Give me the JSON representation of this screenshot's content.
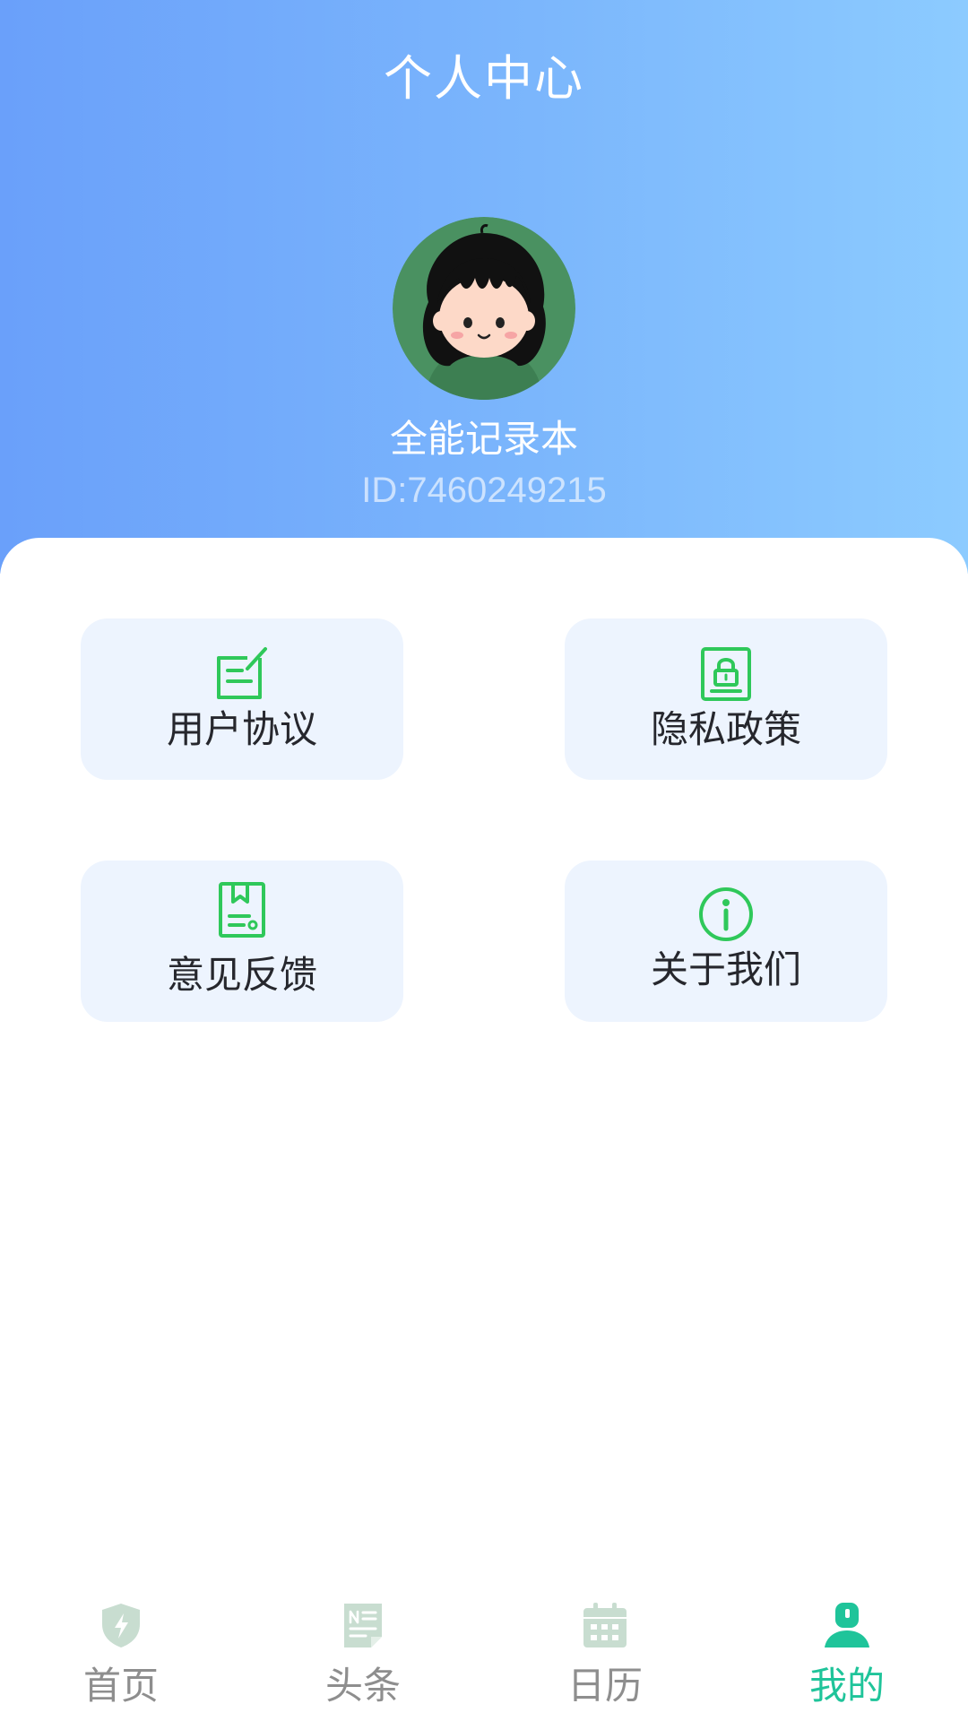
{
  "header": {
    "title": "个人中心"
  },
  "profile": {
    "name": "全能记录本",
    "id_text": "ID:7460249215",
    "avatar_icon": "girl-avatar-icon"
  },
  "menu": [
    {
      "label": "用户协议",
      "icon": "edit-document-icon"
    },
    {
      "label": "隐私政策",
      "icon": "privacy-lock-icon"
    },
    {
      "label": "意见反馈",
      "icon": "feedback-bookmark-icon"
    },
    {
      "label": "关于我们",
      "icon": "info-icon"
    }
  ],
  "tabbar": {
    "items": [
      {
        "label": "首页",
        "icon": "shield-bolt-icon",
        "active": false
      },
      {
        "label": "头条",
        "icon": "news-icon",
        "active": false
      },
      {
        "label": "日历",
        "icon": "calendar-icon",
        "active": false
      },
      {
        "label": "我的",
        "icon": "user-icon",
        "active": true
      }
    ]
  },
  "colors": {
    "header_start": "#6aa0fa",
    "header_end": "#8ccbff",
    "card_bg": "#edf4fe",
    "icon_green": "#2fc85a",
    "tab_active": "#1fc49a",
    "tab_inactive_text": "#8e8e8e",
    "tab_inactive_icon": "#c8ddd0"
  }
}
